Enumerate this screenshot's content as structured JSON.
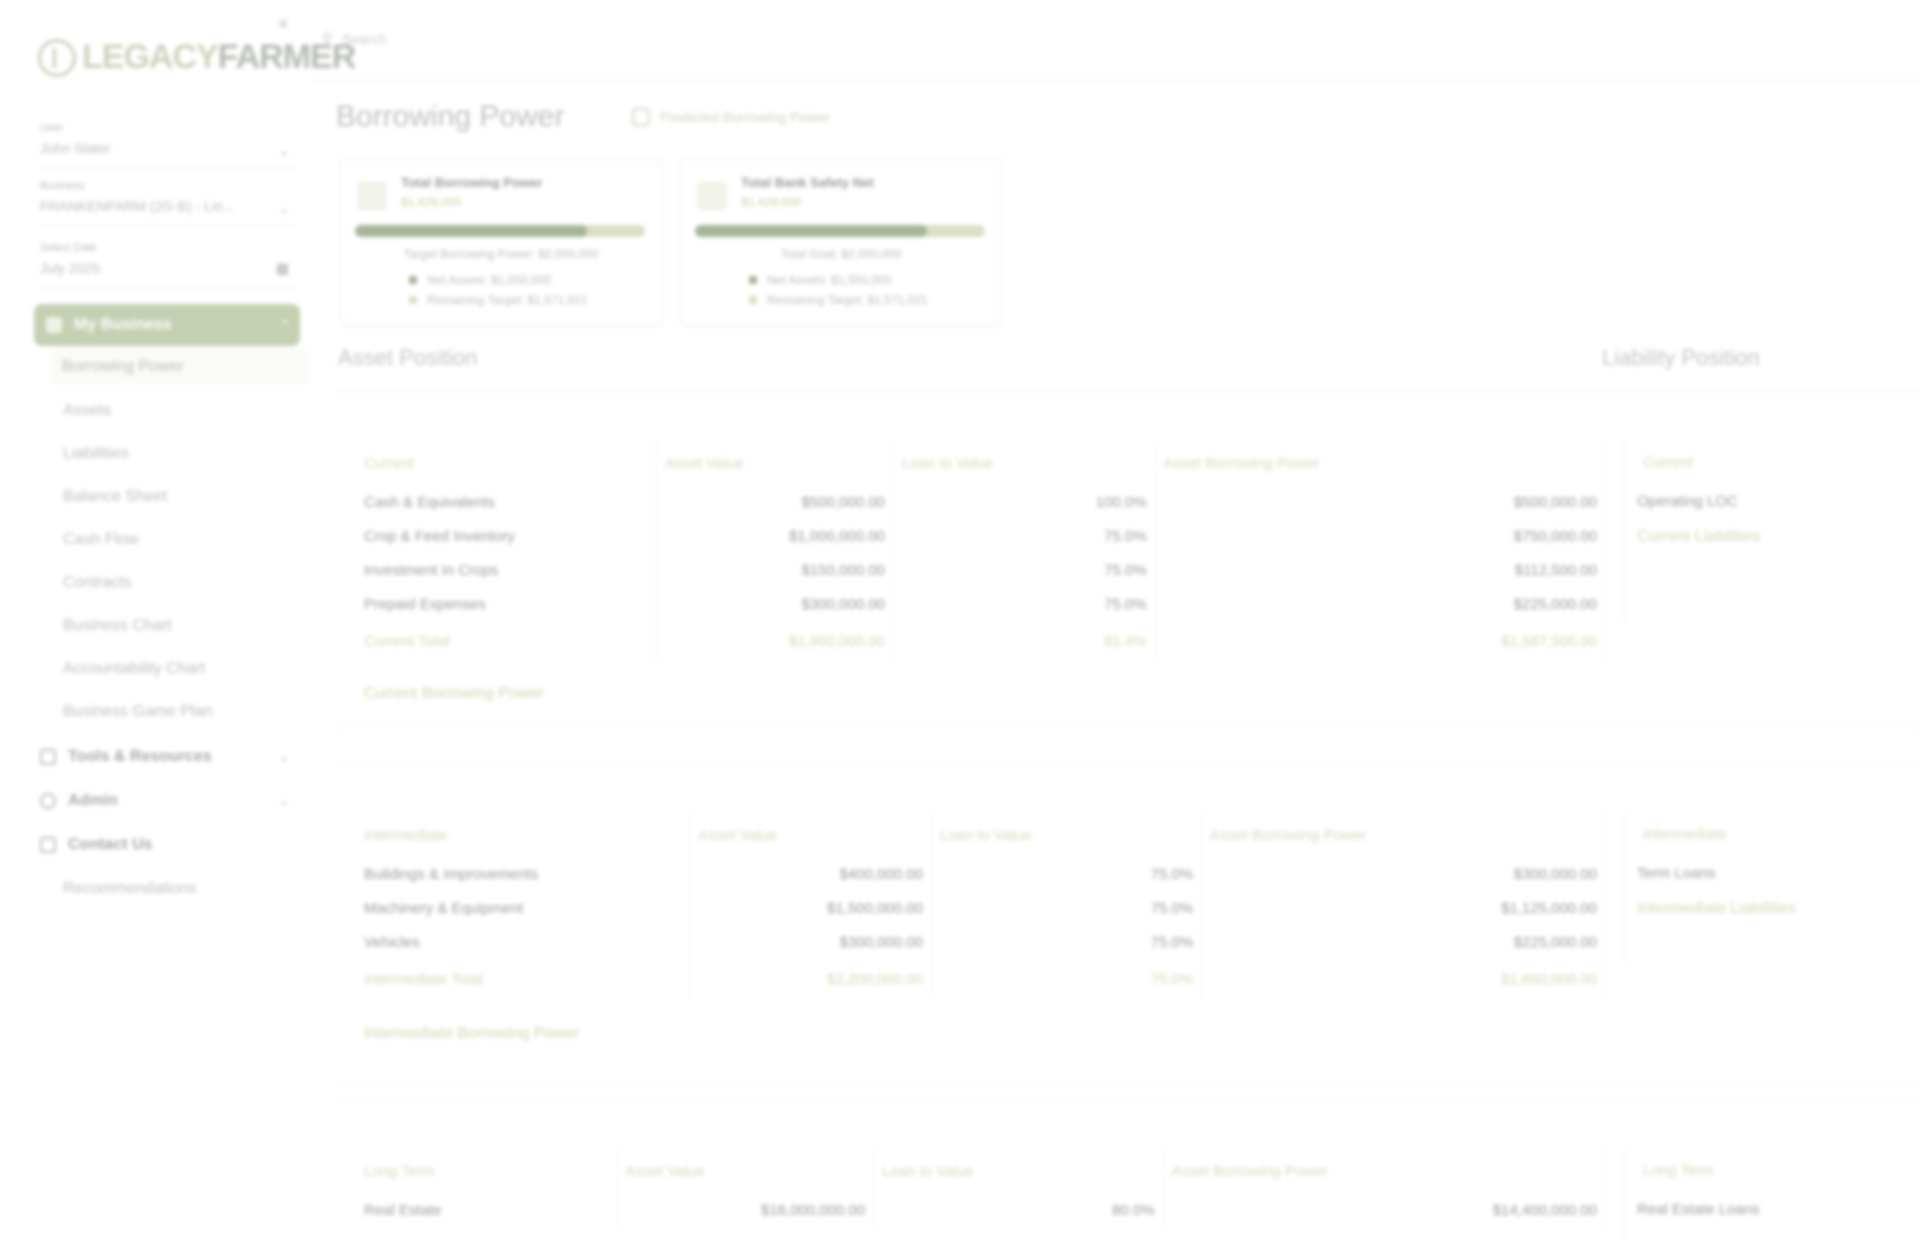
{
  "sidebar": {
    "brand": {
      "part1": "LEGACY",
      "part2": "FARMER"
    },
    "fields": [
      {
        "label": "User",
        "value": "John Slater"
      },
      {
        "label": "Business",
        "value": "FRANKENFARM (2G-B) - Lin..."
      },
      {
        "label": "Select Date",
        "value": "July 2025"
      }
    ],
    "active_section": "My Business",
    "sub_items": [
      "Borrowing Power",
      "Assets",
      "Liabilities",
      "Balance Sheet",
      "Cash Flow",
      "Contracts",
      "Business Chart",
      "Accountability Chart",
      "Business Game Plan"
    ],
    "nav_items": [
      "Tools & Resources",
      "Admin",
      "Contact Us"
    ],
    "extra_item": "Recommendations"
  },
  "search": {
    "placeholder": "Search"
  },
  "page": {
    "title": "Borrowing Power",
    "predicted_label": "Predicted Borrowing Power"
  },
  "cards": [
    {
      "title": "Total Borrowing Power",
      "value": "$1,429,000",
      "target": "Target Borrowing Power: $2,000,000",
      "progress": 0.8,
      "legend": [
        "Net Assets: $1,550,000",
        "Remaining Target: $1,571,021"
      ]
    },
    {
      "title": "Total Bank Safety Net",
      "value": "$1,429,000",
      "target": "Total Goal: $2,000,000",
      "progress": 0.8,
      "legend": [
        "Net Assets: $1,550,000",
        "Remaining Target: $1,571,021"
      ]
    }
  ],
  "sections": {
    "assets": "Asset Position",
    "liabilities": "Liability Position"
  },
  "current": {
    "headers": [
      "Current",
      "Asset Value",
      "Loan to Value",
      "Asset Borrowing Power"
    ],
    "rows": [
      [
        "Cash & Equivalents",
        "$500,000.00",
        "100.0%",
        "$500,000.00"
      ],
      [
        "Crop & Feed Inventory",
        "$1,000,000.00",
        "75.0%",
        "$750,000.00"
      ],
      [
        "Investment In Crops",
        "$150,000.00",
        "75.0%",
        "$112,500.00"
      ],
      [
        "Prepaid Expenses",
        "$300,000.00",
        "75.0%",
        "$225,000.00"
      ]
    ],
    "total": [
      "Current Total",
      "$1,950,000.00",
      "81.4%",
      "$1,587,500.00"
    ],
    "bp_label": "Current Borrowing Power",
    "liab_header": "Current",
    "liab_rows": [
      "Operating LOC"
    ],
    "liab_total": "Current Liabilities"
  },
  "intermediate": {
    "headers": [
      "Intermediate",
      "Asset Value",
      "Loan to Value",
      "Asset Borrowing Power"
    ],
    "rows": [
      [
        "Buildings & Improvements",
        "$400,000.00",
        "75.0%",
        "$300,000.00"
      ],
      [
        "Machinery & Equipment",
        "$1,500,000.00",
        "75.0%",
        "$1,125,000.00"
      ],
      [
        "Vehicles",
        "$300,000.00",
        "75.0%",
        "$225,000.00"
      ]
    ],
    "total": [
      "Intermediate Total",
      "$2,200,000.00",
      "75.0%",
      "$1,650,000.00"
    ],
    "bp_label": "Intermediate Borrowing Power",
    "liab_header": "Intermediate",
    "liab_rows": [
      "Term Loans"
    ],
    "liab_total": "Intermediate Liabilities"
  },
  "longterm": {
    "headers": [
      "Long Term",
      "Asset Value",
      "Loan to Value",
      "Asset Borrowing Power"
    ],
    "rows": [
      [
        "Real Estate",
        "$18,000,000.00",
        "80.0%",
        "$14,400,000.00"
      ]
    ],
    "liab_header": "Long Term",
    "liab_rows": [
      "Real Estate Loans"
    ]
  },
  "colors": {
    "accent": "#c5d0b2",
    "bar_fill": "#a6b497",
    "bar_track": "#d9e0c3",
    "label_green": "#d3d8b3"
  }
}
